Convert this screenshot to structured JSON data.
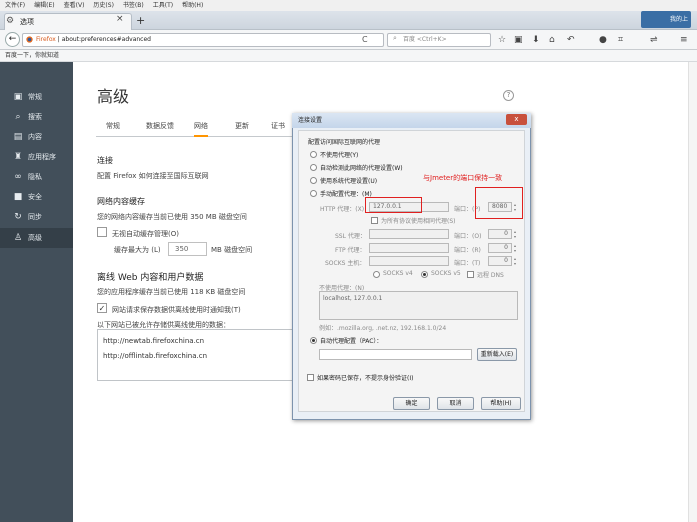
{
  "menubar": [
    "文件(F)",
    "编辑(E)",
    "查看(V)",
    "历史(S)",
    "书签(B)",
    "工具(T)",
    "帮助(H)"
  ],
  "tab": {
    "title": "选项",
    "close": "×",
    "new_tab": "+"
  },
  "window": {
    "account_label": "我的上"
  },
  "navbar": {
    "back": "←",
    "url_brand": "Firefox",
    "url": "about:preferences#advanced",
    "reload": "C",
    "search_placeholder": "百度 <Ctrl+K>"
  },
  "bookmarks": {
    "item": "百度一下，你就知道"
  },
  "sidebar": {
    "items": [
      {
        "label": "常规",
        "icon": "▣"
      },
      {
        "label": "搜索",
        "icon": "⌕"
      },
      {
        "label": "内容",
        "icon": "▤"
      },
      {
        "label": "应用程序",
        "icon": "♜"
      },
      {
        "label": "隐私",
        "icon": "∞"
      },
      {
        "label": "安全",
        "icon": "■"
      },
      {
        "label": "同步",
        "icon": "↻"
      },
      {
        "label": "高级",
        "icon": "♙"
      }
    ],
    "active_index": 7
  },
  "main": {
    "title": "高级",
    "help": "?",
    "tabs": [
      "常规",
      "数据反馈",
      "网络",
      "更新",
      "证书"
    ],
    "selected_tab": 2,
    "connection": {
      "title": "连接",
      "desc": "配置 Firefox 如何连接至国际互联网"
    },
    "cache": {
      "title": "网络内容缓存",
      "desc": "您的网络内容缓存当前已使用 350 MB 磁盘空间",
      "override_label": "无视自动缓存管理(O)",
      "limit_label": "缓存最大为 (L)",
      "limit_value": "350",
      "unit": "MB 磁盘空间"
    },
    "offline": {
      "title": "离线 Web 内容和用户数据",
      "desc": "您的应用程序缓存当前已使用 118 KB 磁盘空间",
      "notify_label": "网站请求保存数据供离线使用时通知我(T)",
      "notify_checked": "✓",
      "list_label": "以下网站已被允许存储供离线使用的数据：",
      "sites": [
        "http://newtab.firefoxchina.cn",
        "http://offlintab.firefoxchina.cn"
      ]
    }
  },
  "dialog": {
    "title": "连接设置",
    "close": "x",
    "heading": "配置访问国际互联网的代理",
    "options": [
      "不使用代理(Y)",
      "自动检测此网络的代理设置(W)",
      "使用系统代理设置(U)",
      "手动配置代理：(M)"
    ],
    "http_label": "HTTP 代理：(X)",
    "http_value": "127.0.0.1",
    "port_label": "端口：(P)",
    "http_port": "8080",
    "same_proxy": "为所有协议使用相同代理(S)",
    "ssl_label": "SSL 代理：",
    "ftp_label": "FTP 代理：",
    "socks_label": "SOCKS 主机：",
    "port_labels": [
      "端口：(O)",
      "端口：(R)",
      "端口：(T)"
    ],
    "port_zero": "0",
    "socks_v4": "SOCKS v4",
    "socks_v5": "SOCKS v5",
    "remote_dns": "远程 DNS",
    "no_proxy_label": "不使用代理：(N)",
    "no_proxy_value": "localhost, 127.0.0.1",
    "example": "例如：.mozilla.org, .net.nz, 192.168.1.0/24",
    "pac_label": "自动代理配置（PAC）：",
    "reload_btn": "重新载入(E)",
    "no_prompt": "如果密码已保存，不提示身份验证(I)",
    "ok": "确定",
    "cancel": "取消",
    "help": "帮助(H)"
  },
  "annotation": {
    "text": "与Jmeter的端口保持一致"
  }
}
